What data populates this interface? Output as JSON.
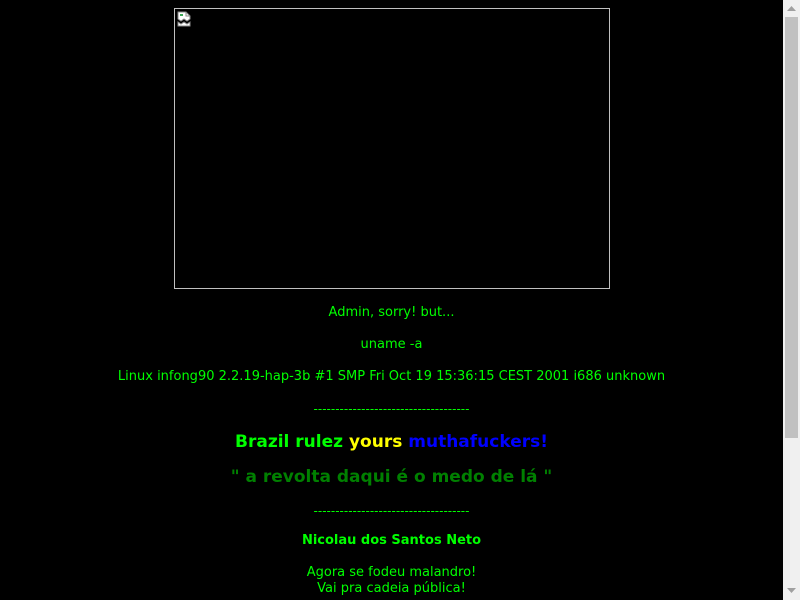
{
  "page": {
    "background": "#000000",
    "header_image": {
      "alt": "",
      "icon": "broken-image-icon"
    },
    "line_admin": "Admin, sorry! but...",
    "line_uname_cmd": "uname -a",
    "line_uname_output": "Linux infong90 2.2.19-hap-3b #1 SMP Fri Oct 19 15:36:15 CEST 2001 i686 unknown",
    "divider_top": "------------------------------------",
    "slogan": {
      "part1": "Brazil rulez",
      "part2": "yours",
      "part3": "muthafuckers!"
    },
    "quote": "\" a revolta daqui é o medo de lá \"",
    "divider_bottom": "------------------------------------",
    "author": "Nicolau dos Santos Neto",
    "closing_line1": "Agora se fodeu malandro!",
    "closing_line2": "Vai pra cadeia pública!"
  },
  "colors": {
    "primary_text": "#00ff00",
    "yellow_text": "#ffff00",
    "blue_text": "#0000ff",
    "quote_text": "#008000"
  },
  "scrollbar": {
    "up_icon": "chevron-up-icon",
    "down_icon": "chevron-down-icon"
  }
}
